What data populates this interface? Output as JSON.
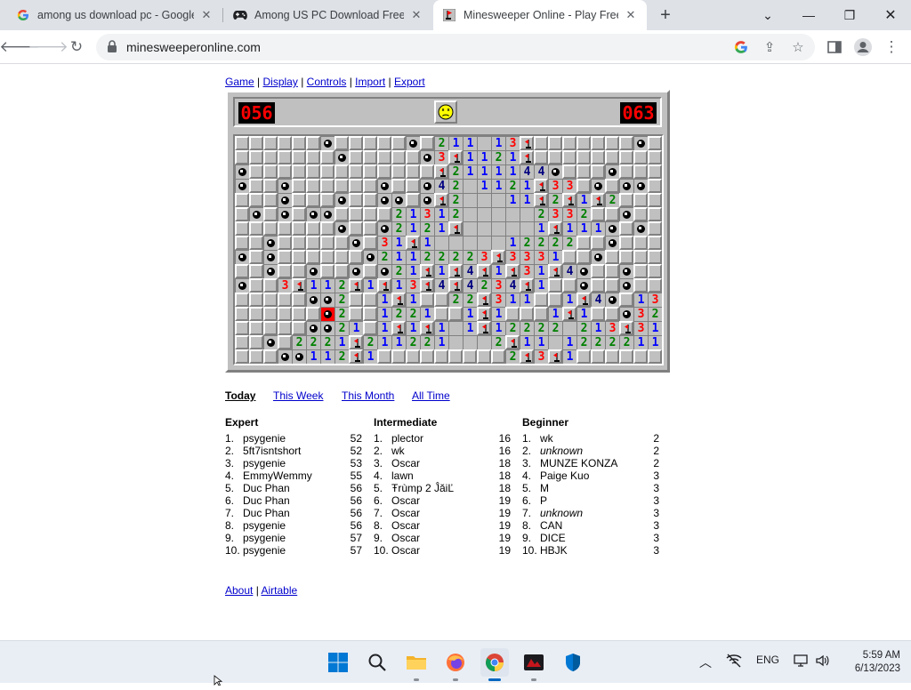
{
  "browser": {
    "tabs": [
      {
        "title": "among us download pc - Google",
        "icon": "google-g-icon"
      },
      {
        "title": "Among US PC Download Free Ga",
        "icon": "gamepad-icon"
      },
      {
        "title": "Minesweeper Online - Play Free",
        "icon": "minesweeper-icon"
      }
    ],
    "url": "minesweeperonline.com"
  },
  "menu": {
    "game": "Game",
    "display": "Display",
    "controls": "Controls",
    "import": "Import",
    "export": "Export",
    "sep": "|"
  },
  "hud": {
    "mines_left": "056",
    "timer": "063",
    "face": "dead"
  },
  "board": {
    "cols": 30,
    "rows": 16,
    "legend": "# closed, . open, * mine, X exploded mine, F flag, 1-8 number",
    "grid": [
      "######*#####*#211.13F#######*###",
      "#######*#####*3F1121F#########",
      "*#############F2111144*###*###",
      "*##*######*##*42.1121F33#*#**#",
      "###*###*##**#*F2...11F2F1F2###",
      "#*#*#**####21312.....2332##*#",
      "#######*##*2121F.....1F111*#*#",
      "##*#####*#31F1.....12222##*##",
      "*#*######*21122223F3331##*##",
      "##*##*##*#*21F1F4F1F31F4*##*",
      "*##3F112F1F13F4F4234F1##*##*#",
      "#####**2##1F1##22F311##1F4*#1324*",
      "######X2##1221##1F1###1F1##*321F1",
      "#####**21#1F1F1.1F12222.213F31F1122",
      "##*#2221F211221...2F11.1222211##",
      "###**112F1#########2F3F1#########"
    ]
  },
  "leaderboard": {
    "tabs": [
      "Today",
      "This Week",
      "This Month",
      "All Time"
    ],
    "columns": [
      {
        "title": "Expert",
        "entries": [
          {
            "rank": "1.",
            "name": "psygenie",
            "score": "52"
          },
          {
            "rank": "2.",
            "name": "5ft7isntshort",
            "score": "52"
          },
          {
            "rank": "3.",
            "name": "psygenie",
            "score": "53"
          },
          {
            "rank": "4.",
            "name": "EmmyWemmy",
            "score": "55"
          },
          {
            "rank": "5.",
            "name": "Duc Phan",
            "score": "56"
          },
          {
            "rank": "6.",
            "name": "Duc Phan",
            "score": "56"
          },
          {
            "rank": "7.",
            "name": "Duc Phan",
            "score": "56"
          },
          {
            "rank": "8.",
            "name": "psygenie",
            "score": "56"
          },
          {
            "rank": "9.",
            "name": "psygenie",
            "score": "57"
          },
          {
            "rank": "10.",
            "name": "psygenie",
            "score": "57"
          }
        ]
      },
      {
        "title": "Intermediate",
        "entries": [
          {
            "rank": "1.",
            "name": "plector",
            "score": "16"
          },
          {
            "rank": "2.",
            "name": "wk",
            "score": "16"
          },
          {
            "rank": "3.",
            "name": "Oscar",
            "score": "18"
          },
          {
            "rank": "4.",
            "name": "lawn",
            "score": "18"
          },
          {
            "rank": "5.",
            "name": "Ŧrùmp 2 ĴăiĽ",
            "score": "18"
          },
          {
            "rank": "6.",
            "name": "Oscar",
            "score": "19"
          },
          {
            "rank": "7.",
            "name": "Oscar",
            "score": "19"
          },
          {
            "rank": "8.",
            "name": "Oscar",
            "score": "19"
          },
          {
            "rank": "9.",
            "name": "Oscar",
            "score": "19"
          },
          {
            "rank": "10.",
            "name": "Oscar",
            "score": "19"
          }
        ]
      },
      {
        "title": "Beginner",
        "entries": [
          {
            "rank": "1.",
            "name": "wk",
            "score": "2"
          },
          {
            "rank": "2.",
            "name": "unknown",
            "score": "2",
            "italic": true
          },
          {
            "rank": "3.",
            "name": "MUNZE KONZA",
            "score": "2"
          },
          {
            "rank": "4.",
            "name": "Paige Kuo",
            "score": "3"
          },
          {
            "rank": "5.",
            "name": "M",
            "score": "3"
          },
          {
            "rank": "6.",
            "name": "P",
            "score": "3"
          },
          {
            "rank": "7.",
            "name": "unknown",
            "score": "3",
            "italic": true
          },
          {
            "rank": "8.",
            "name": "CAN",
            "score": "3"
          },
          {
            "rank": "9.",
            "name": "DICE",
            "score": "3"
          },
          {
            "rank": "10.",
            "name": "HBJK",
            "score": "3"
          }
        ]
      }
    ]
  },
  "footer": {
    "about": "About",
    "airtable": "Airtable",
    "sep": "|"
  },
  "taskbar": {
    "lang": "ENG",
    "time": "5:59 AM",
    "date": "6/13/2023"
  }
}
